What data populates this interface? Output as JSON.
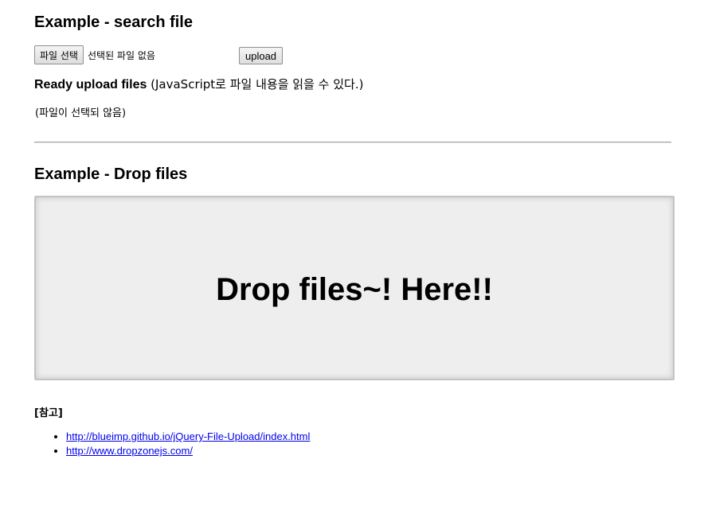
{
  "search_section": {
    "title": "Example - search file",
    "file_button_label": "파일 선택",
    "file_status": "선택된 파일 없음",
    "upload_label": "upload",
    "ready_label": "Ready upload files",
    "ready_note": " (JavaScript로 파일 내용을 읽을 수 있다.)",
    "no_file_text": "(파일이 선택되 않음)"
  },
  "drop_section": {
    "title": "Example - Drop files",
    "drop_text": "Drop files~! Here!!"
  },
  "references": {
    "title": "[참고]",
    "links": [
      "http://blueimp.github.io/jQuery-File-Upload/index.html",
      "http://www.dropzonejs.com/"
    ]
  }
}
